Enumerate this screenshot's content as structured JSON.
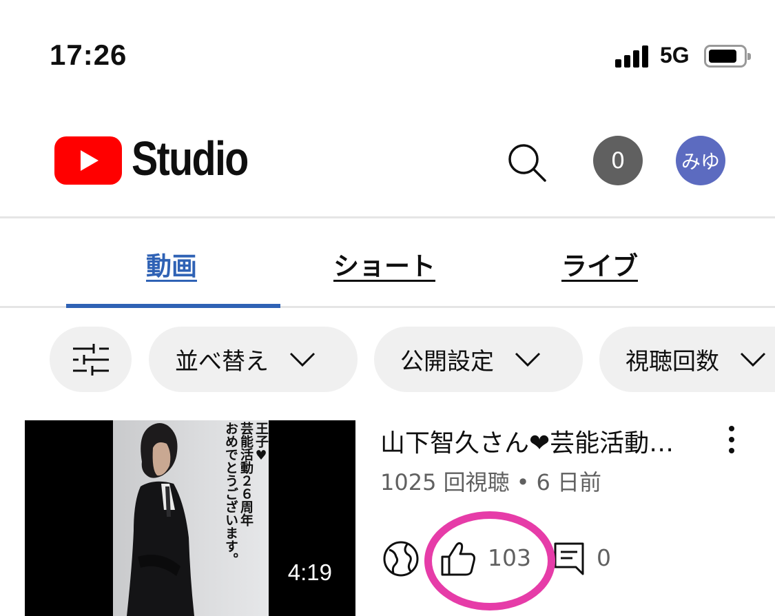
{
  "status_bar": {
    "time": "17:26",
    "network": "5G"
  },
  "header": {
    "logo_text": "Studio",
    "notification_count": "0",
    "avatar_initials": "みゆ"
  },
  "tabs": [
    {
      "label": "動画",
      "active": true
    },
    {
      "label": "ショート",
      "active": false
    },
    {
      "label": "ライブ",
      "active": false
    }
  ],
  "filters": [
    {
      "label": "並べ替え"
    },
    {
      "label": "公開設定"
    },
    {
      "label": "視聴回数"
    }
  ],
  "video": {
    "title": "山下智久さん❤芸能活動…",
    "views": "1025 回視聴",
    "separator": "•",
    "age": "6 日前",
    "duration": "4:19",
    "likes": "103",
    "comments": "0",
    "thumbnail_text": [
      "王子♥",
      "芸能活動２６周年",
      "おめでとうございます。"
    ]
  },
  "colors": {
    "accent": "#2f62b5",
    "brand_red": "#ff0000",
    "highlight": "#e63ca8",
    "avatar": "#5c6bc0"
  }
}
